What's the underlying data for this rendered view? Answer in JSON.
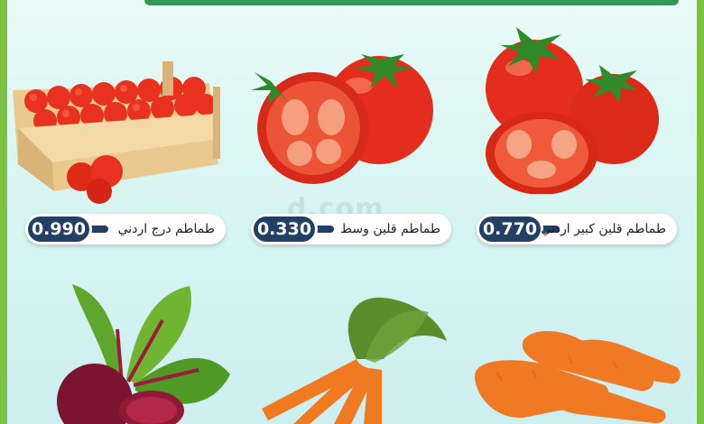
{
  "watermark": "d.com",
  "products": [
    {
      "name": "طماطم قلين كبير اردني",
      "price": "0.770",
      "image": "tomatoes-and-half-tomato"
    },
    {
      "name": "طماطم قلين وسط",
      "price": "0.330",
      "image": "tomato-and-cut-tomato"
    },
    {
      "name": "طماطم درج اردني",
      "price": "0.990",
      "image": "tomato-crate"
    },
    {
      "name": "",
      "price": "",
      "image": "carrots-loose"
    },
    {
      "name": "",
      "price": "",
      "image": "carrot-bunch"
    },
    {
      "name": "",
      "price": "",
      "image": "beetroot"
    }
  ],
  "colors": {
    "frame": "#7bc142",
    "top_bar": "#2f9a55",
    "price_pill": "#233f63",
    "background": "#dff7f3"
  }
}
